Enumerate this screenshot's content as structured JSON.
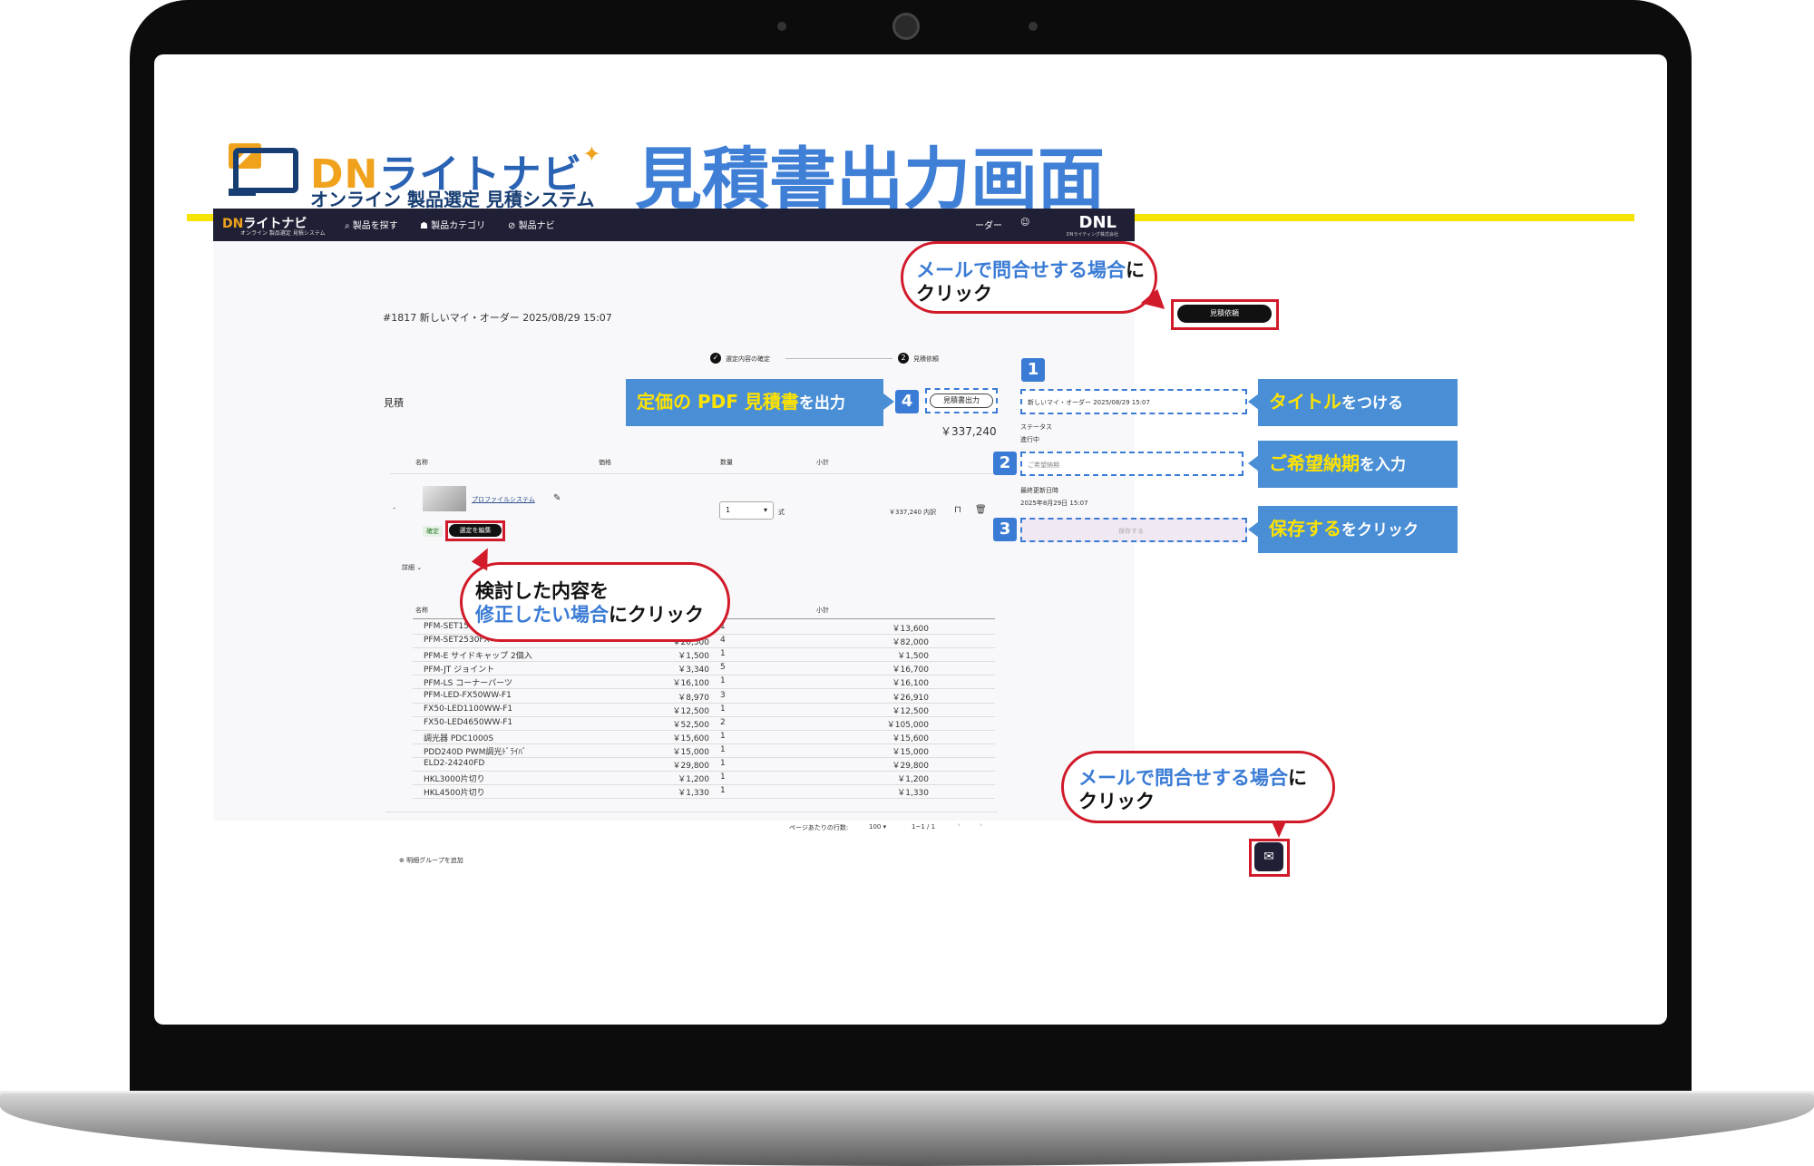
{
  "slide": {
    "logo_main_dn": "DN",
    "logo_main_rest": "ライトナビ",
    "logo_sub": "オンライン 製品選定 見積システム",
    "headline": "見積書出力画面"
  },
  "nav": {
    "logo_dn": "DN",
    "logo_rest": "ライトナビ",
    "logo_sub": "オンライン 製品選定 見積システム",
    "items": [
      "製品を探す",
      "製品カテゴリ",
      "製品ナビ"
    ],
    "user_suffix": "ーダー",
    "brand": "DNL",
    "brand_sub": "DNライティング株式会社"
  },
  "order": {
    "title": "#1817 新しいマイ・オーダー 2025/08/29 15:07",
    "request_button": "見積依頼"
  },
  "stepper": {
    "step1": "選定内容の確定",
    "step2": "見積依頼",
    "step2_num": "2"
  },
  "estimate": {
    "heading": "見積",
    "pdf_button": "見積書出力",
    "total": "￥337,240",
    "columns": [
      "名称",
      "価格",
      "数量",
      "小計"
    ],
    "product_name": "プロファイルシステム",
    "status_chip": "確定",
    "edit_button": "選定を編集",
    "qty": "1",
    "qty_unit": "式",
    "line_total": "￥337,240 内訳",
    "details_toggle": "詳細",
    "detail_columns": [
      "名称",
      "価格",
      "数量",
      "小計"
    ],
    "rows": [
      {
        "name": "PFM-SET1520FX",
        "price": "",
        "qty": "1",
        "subtotal": "￥13,600"
      },
      {
        "name": "PFM-SET2530FX",
        "price": "￥20,500",
        "qty": "4",
        "subtotal": "￥82,000"
      },
      {
        "name": "PFM-E サイドキャップ 2個入",
        "price": "￥1,500",
        "qty": "1",
        "subtotal": "￥1,500"
      },
      {
        "name": "PFM-JT ジョイント",
        "price": "￥3,340",
        "qty": "5",
        "subtotal": "￥16,700"
      },
      {
        "name": "PFM-LS コーナーパーツ",
        "price": "￥16,100",
        "qty": "1",
        "subtotal": "￥16,100"
      },
      {
        "name": "PFM-LED-FX50WW-F1",
        "price": "￥8,970",
        "qty": "3",
        "subtotal": "￥26,910"
      },
      {
        "name": "FX50-LED1100WW-F1",
        "price": "￥12,500",
        "qty": "1",
        "subtotal": "￥12,500"
      },
      {
        "name": "FX50-LED4650WW-F1",
        "price": "￥52,500",
        "qty": "2",
        "subtotal": "￥105,000"
      },
      {
        "name": "調光器 PDC1000S",
        "price": "￥15,600",
        "qty": "1",
        "subtotal": "￥15,600"
      },
      {
        "name": "PDD240D PWM調光ﾄﾞﾗｲﾊﾞ",
        "price": "￥15,000",
        "qty": "1",
        "subtotal": "￥15,000"
      },
      {
        "name": "ELD2-24240FD",
        "price": "￥29,800",
        "qty": "1",
        "subtotal": "￥29,800"
      },
      {
        "name": "HKL3000片切り",
        "price": "￥1,200",
        "qty": "1",
        "subtotal": "￥1,200"
      },
      {
        "name": "HKL4500片切り",
        "price": "￥1,330",
        "qty": "1",
        "subtotal": "￥1,330"
      }
    ],
    "pager_label": "ページあたりの行数:",
    "pager_size": "100",
    "pager_range": "1~1 / 1",
    "add_group": "明細グループを追加"
  },
  "side": {
    "title_value": "新しいマイ・オーダー 2025/08/29 15:07",
    "status_label": "ステータス",
    "status_value": "進行中",
    "date_placeholder": "ご希望納期",
    "updated_label": "最終更新日時",
    "updated_value": "2025年8月29日 15:07",
    "save_button": "保存する"
  },
  "annotations": {
    "badge1": "1",
    "badge2": "2",
    "badge3": "3",
    "badge4": "4",
    "flag_title_y": "タイトル",
    "flag_title_s": "をつける",
    "flag_date_y": "ご希望納期",
    "flag_date_s": "を入力",
    "flag_save_y": "保存する",
    "flag_save_s": "をクリック",
    "flag_pdf_y": "定価の PDF 見積書",
    "flag_pdf_s": "を出力",
    "bubble_top_b": "メールで問合せする場合",
    "bubble_top_n1": "に",
    "bubble_top_n2": "クリック",
    "bubble_edit_n1": "検討した内容を",
    "bubble_edit_b": "修正したい場合",
    "bubble_edit_n2": "にクリック",
    "bubble_mail_b": "メールで問合せする場合",
    "bubble_mail_n1": "に",
    "bubble_mail_n2": "クリック"
  },
  "icons": [
    "search-icon",
    "category-icon",
    "compass-icon",
    "user-icon",
    "edit-pencil-icon",
    "bookmark-icon",
    "trash-icon",
    "chevron-down-icon",
    "plus-circle-icon",
    "mail-icon"
  ]
}
